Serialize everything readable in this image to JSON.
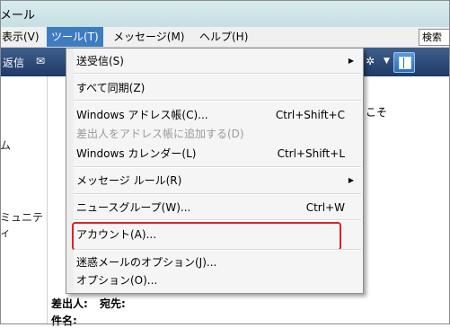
{
  "window": {
    "title": "メール"
  },
  "menubar": {
    "items": [
      {
        "label": "表示(V)"
      },
      {
        "label": "ツール(T)"
      },
      {
        "label": "メッセージ(M)"
      },
      {
        "label": "ヘルプ(H)"
      }
    ],
    "search_label": "検索"
  },
  "toolbar": {
    "reply_label": "返信"
  },
  "left_pane": {
    "partial_labels": [
      "ム",
      "ミュニティ"
    ]
  },
  "content": {
    "welcome_text": "うこそ",
    "from_label": "差出人:",
    "to_label": "宛先:",
    "subject_label": "件名:"
  },
  "tools_menu": {
    "items": [
      {
        "label": "送受信(S)",
        "shortcut": "",
        "submenu": true
      },
      {
        "label": "すべて同期(Z)",
        "shortcut": ""
      },
      {
        "label": "Windows アドレス帳(C)...",
        "shortcut": "Ctrl+Shift+C"
      },
      {
        "label": "差出人をアドレス帳に追加する(D)",
        "shortcut": "",
        "disabled": true
      },
      {
        "label": "Windows カレンダー(L)",
        "shortcut": "Ctrl+Shift+L"
      },
      {
        "label": "メッセージ ルール(R)",
        "shortcut": "",
        "submenu": true
      },
      {
        "label": "ニュースグループ(W)...",
        "shortcut": "Ctrl+W"
      },
      {
        "label": "アカウント(A)...",
        "shortcut": "",
        "highlighted": true
      },
      {
        "label": "迷惑メールのオプション(J)...",
        "shortcut": ""
      },
      {
        "label": "オプション(O)...",
        "shortcut": ""
      }
    ],
    "highlight_color": "#d62525"
  },
  "colors": {
    "menu_active": "#3e7cc2",
    "toolbar_top": "#3f5f8d",
    "toolbar_bottom": "#1e3a66"
  }
}
